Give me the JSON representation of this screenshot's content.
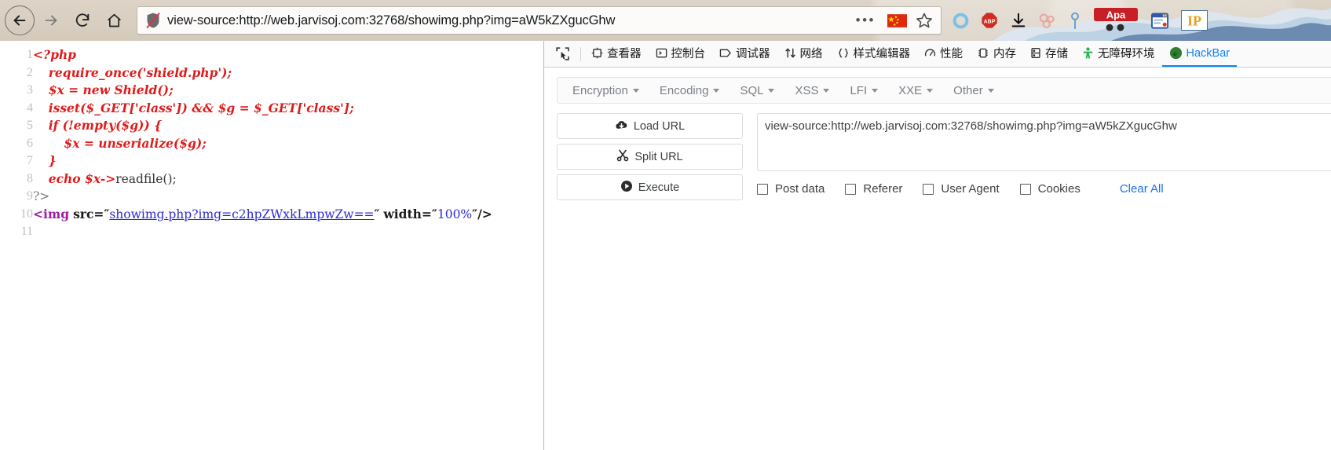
{
  "browser": {
    "url": "view-source:http://web.jarvisoj.com:32768/showimg.php?img=aW5kZXgucGhw",
    "nav": {
      "back": "back-button",
      "forward": "forward-button",
      "reload": "reload-button",
      "home": "home-button"
    },
    "overflow_label": "•••",
    "icons": [
      "page-actions-menu-icon",
      "china-flag-icon",
      "bookmark-star-icon",
      "blue-ring-extension-icon",
      "adblock-plus-icon",
      "downloads-icon",
      "pink-rings-extension-icon",
      "blue-pin-extension-icon",
      "apa-badge-extension-icon",
      "window-extension-icon",
      "ip-extension-icon"
    ],
    "apa_badge": "Apa",
    "abp_badge": "ABP",
    "ip_badge": "IP"
  },
  "source_view": {
    "lines": [
      {
        "n": "1",
        "html": "<span class=\"php\">&lt;?php</span>"
      },
      {
        "n": "2",
        "html": "    <span class=\"php\">require_once('shield.php');</span>"
      },
      {
        "n": "3",
        "html": "    <span class=\"php\">$x = new Shield();</span>"
      },
      {
        "n": "4",
        "html": "    <span class=\"php\">isset($_GET['class']) &amp;&amp; $g = $_GET['class'];</span>"
      },
      {
        "n": "5",
        "html": "    <span class=\"php\">if (!empty($g)) {</span>"
      },
      {
        "n": "6",
        "html": "        <span class=\"php\">$x = unserialize($g);</span>"
      },
      {
        "n": "7",
        "html": "    <span class=\"php\">}</span>"
      },
      {
        "n": "8",
        "html": "    <span class=\"php\">echo $x-&gt;</span><span class=\"plain\">readfile();</span>"
      },
      {
        "n": "9",
        "html": "<span class=\"plain\" style=\"color:#777\">?&gt;</span>"
      },
      {
        "n": "10",
        "html": "<span class=\"tag\">&lt;img</span> <span class=\"attr\">src</span><span class=\"quo\">=″</span><span class=\"link\">showimg.php?img=c2hpZWxkLmpwZw==</span><span class=\"quo\">″</span> <span class=\"attr\">width</span><span class=\"quo\">=″</span><span class=\"val\">100%</span><span class=\"quo\">″/&gt;</span>"
      },
      {
        "n": "11",
        "html": ""
      }
    ],
    "plain_text": [
      "<?php",
      "    require_once('shield.php');",
      "    $x = new Shield();",
      "    isset($_GET['class']) && $g = $_GET['class'];",
      "    if (!empty($g)) {",
      "        $x = unserialize($g);",
      "    }",
      "    echo $x->readfile();",
      "?>",
      "<img src=\"showimg.php?img=c2hpZWxkLmpwZw==\" width=\"100%\"/>",
      ""
    ]
  },
  "devtools": {
    "picker_icon": "element-picker-icon",
    "tabs": [
      {
        "label": "查看器",
        "icon": "inspector-icon",
        "active": false
      },
      {
        "label": "控制台",
        "icon": "console-icon",
        "active": false
      },
      {
        "label": "调试器",
        "icon": "debugger-icon",
        "active": false
      },
      {
        "label": "网络",
        "icon": "network-icon",
        "active": false
      },
      {
        "label": "样式编辑器",
        "icon": "style-editor-icon",
        "active": false
      },
      {
        "label": "性能",
        "icon": "performance-icon",
        "active": false
      },
      {
        "label": "内存",
        "icon": "memory-icon",
        "active": false
      },
      {
        "label": "存储",
        "icon": "storage-icon",
        "active": false
      },
      {
        "label": "无障碍环境",
        "icon": "accessibility-icon",
        "active": false
      },
      {
        "label": "HackBar",
        "icon": "hackbar-icon",
        "active": true
      }
    ],
    "active_tab_color": "#0a84ff"
  },
  "hackbar": {
    "menus": [
      {
        "label": "Encryption"
      },
      {
        "label": "Encoding"
      },
      {
        "label": "SQL"
      },
      {
        "label": "XSS"
      },
      {
        "label": "LFI"
      },
      {
        "label": "XXE"
      },
      {
        "label": "Other"
      }
    ],
    "buttons": [
      {
        "label": "Load URL",
        "icon": "cloud-download-icon"
      },
      {
        "label": "Split URL",
        "icon": "scissors-icon"
      },
      {
        "label": "Execute",
        "icon": "play-circle-icon"
      }
    ],
    "url_value": "view-source:http://web.jarvisoj.com:32768/showimg.php?img=aW5kZXgucGhw",
    "options": [
      {
        "label": "Post data",
        "checked": false
      },
      {
        "label": "Referer",
        "checked": false
      },
      {
        "label": "User Agent",
        "checked": false
      },
      {
        "label": "Cookies",
        "checked": false
      }
    ],
    "clear_all_label": "Clear All",
    "link_color": "#1a73e8"
  }
}
